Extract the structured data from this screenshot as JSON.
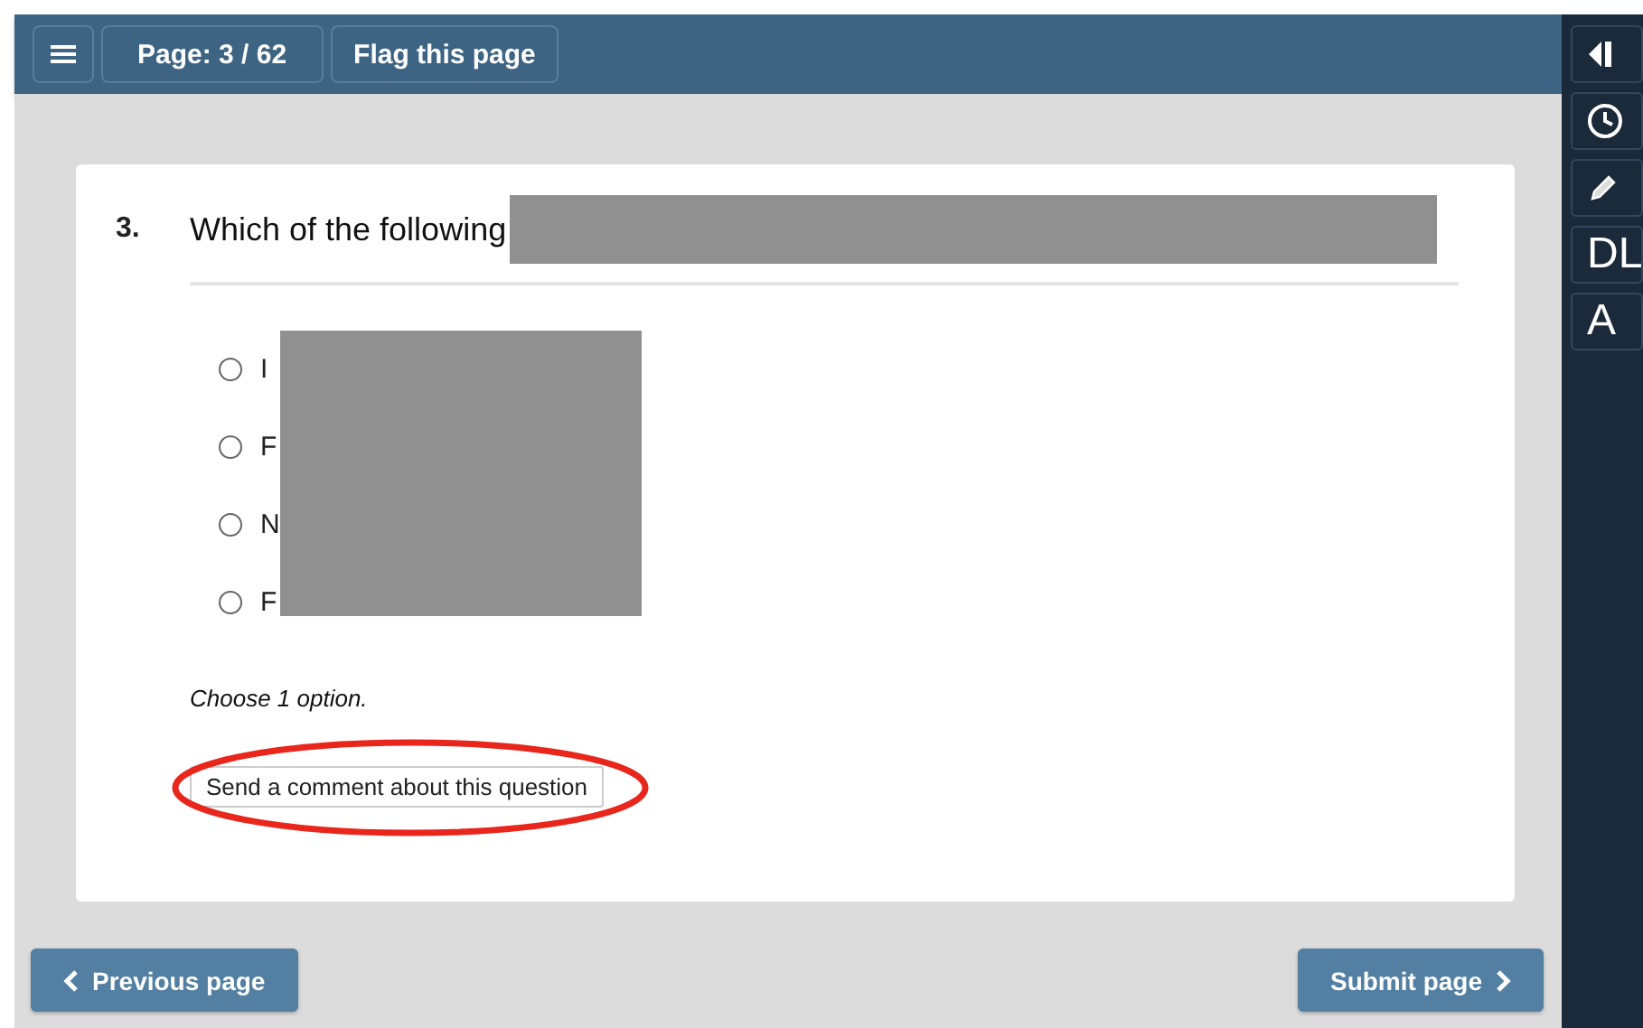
{
  "toolbar": {
    "page_indicator": "Page: 3 / 62",
    "flag_button": "Flag this page"
  },
  "side_panel": {
    "buttons": [
      {
        "kind": "collapse"
      },
      {
        "kind": "clock"
      },
      {
        "kind": "pencil"
      },
      {
        "kind": "text",
        "label": "DL"
      },
      {
        "kind": "text",
        "label": "A"
      }
    ]
  },
  "question": {
    "number": "3.",
    "text": "Which of the following",
    "options": [
      {
        "label": "I",
        "selected": false
      },
      {
        "label": "F",
        "selected": false
      },
      {
        "label": "N",
        "selected": false
      },
      {
        "label": "F",
        "selected": false
      }
    ],
    "instruction": "Choose 1 option.",
    "comment_button": "Send a comment about this question"
  },
  "navigation": {
    "previous": "Previous page",
    "submit": "Submit page"
  }
}
